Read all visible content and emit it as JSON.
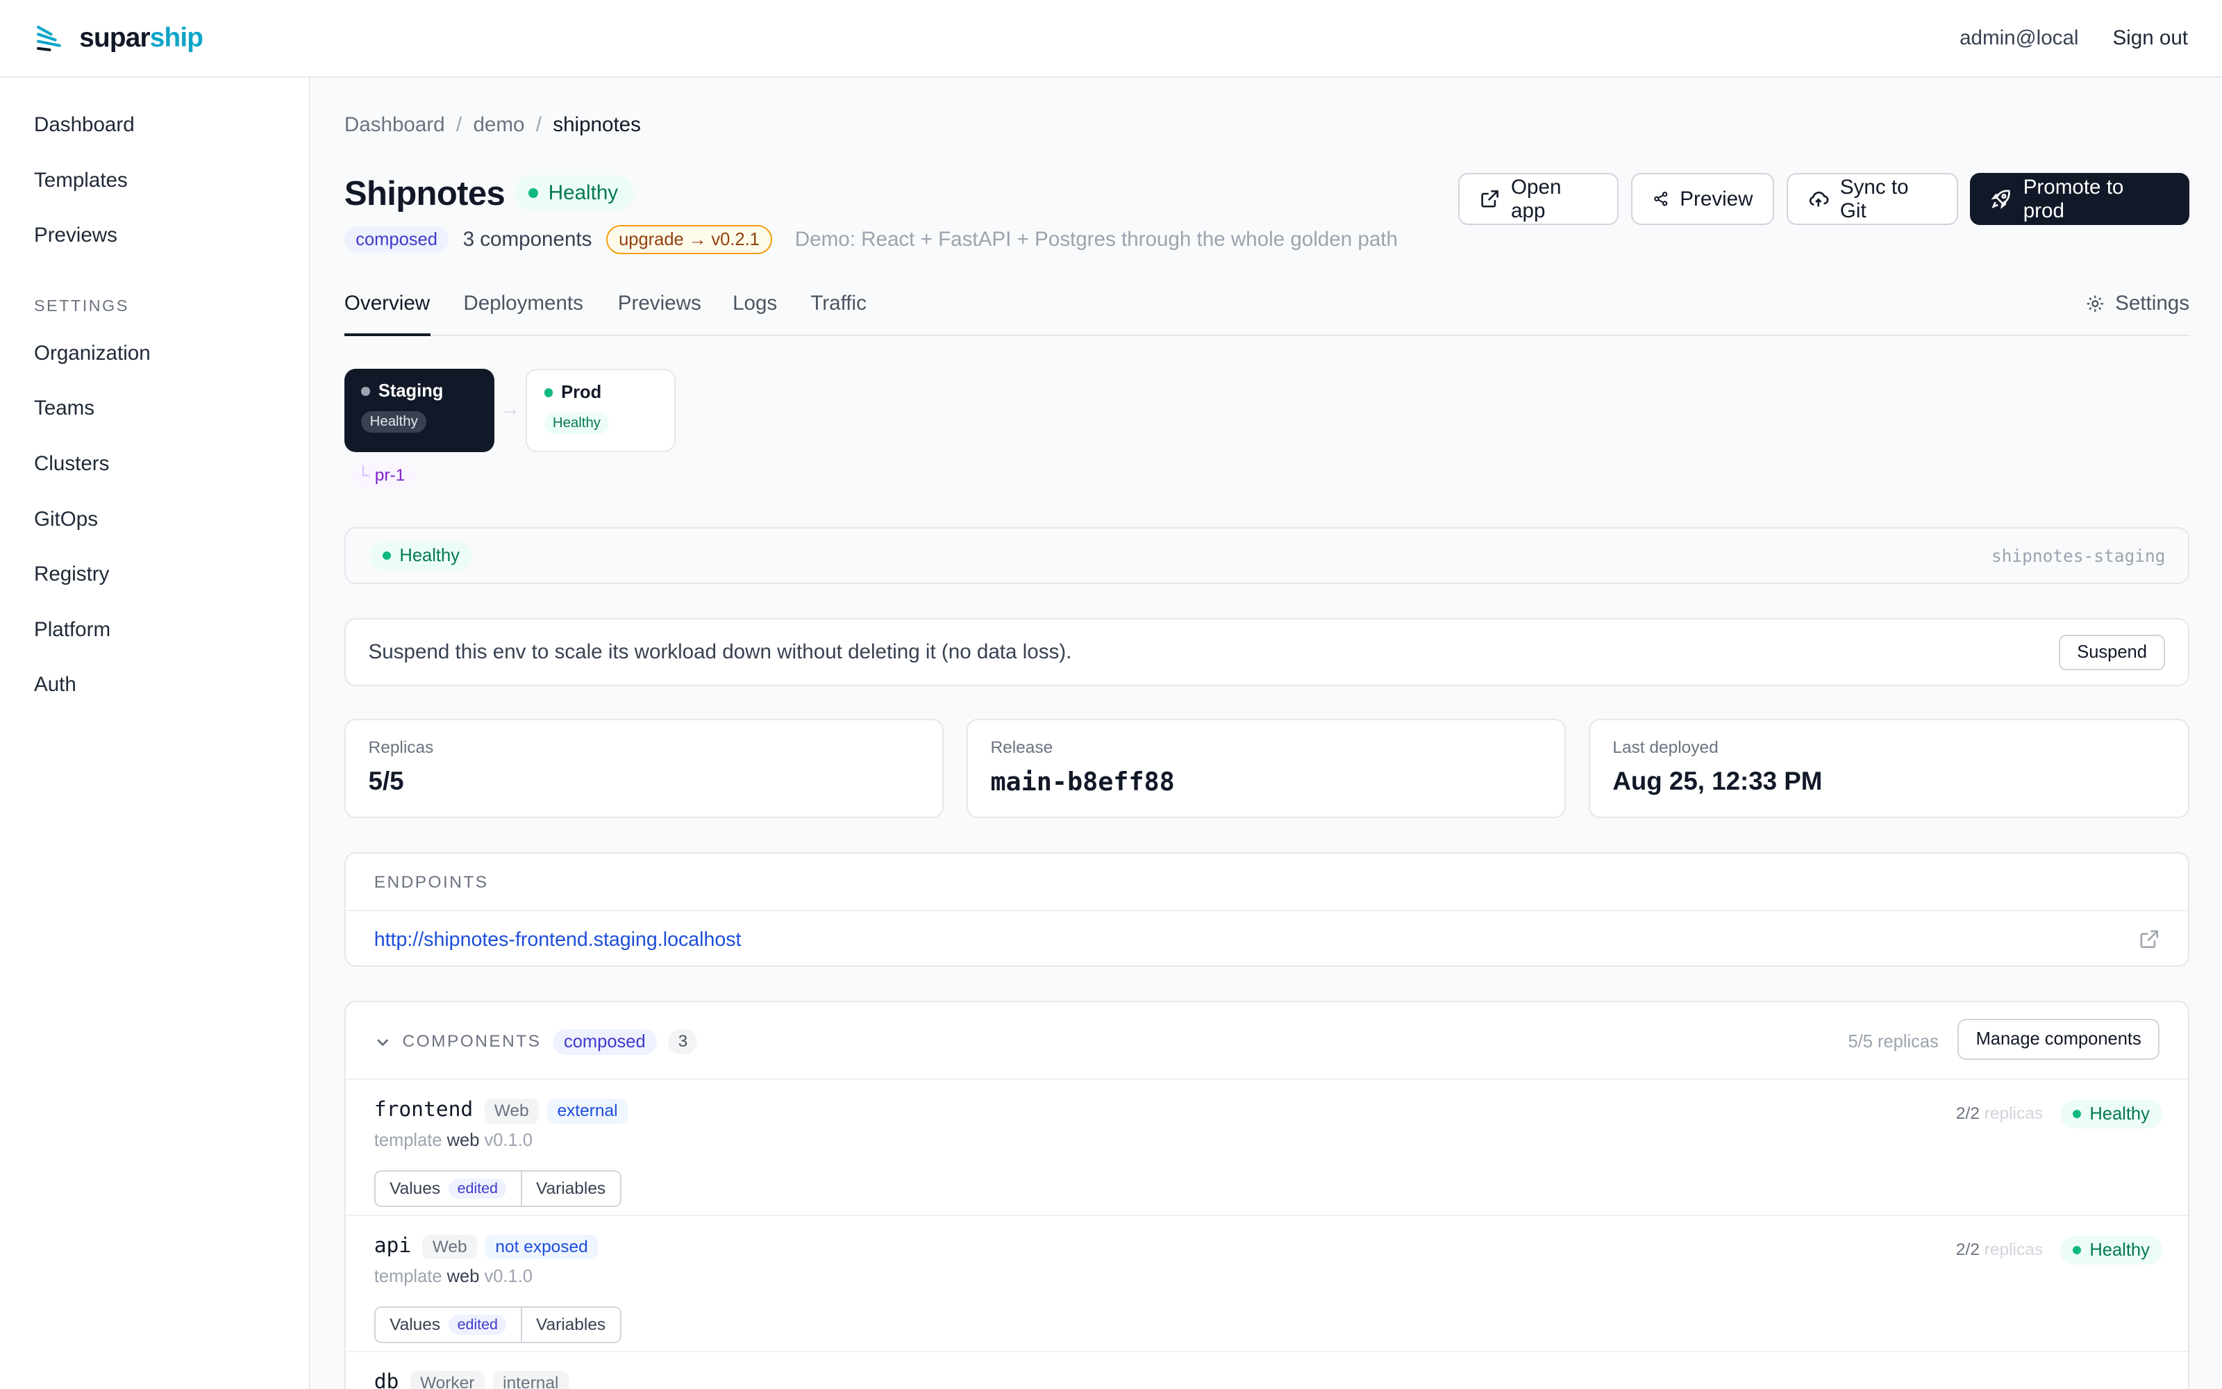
{
  "brand": {
    "part1": "supar",
    "part2": "ship"
  },
  "topbar": {
    "user": "admin@local",
    "signout": "Sign out"
  },
  "sidebar": {
    "items": [
      "Dashboard",
      "Templates",
      "Previews"
    ],
    "settings_header": "SETTINGS",
    "settings_items": [
      "Organization",
      "Teams",
      "Clusters",
      "GitOps",
      "Registry",
      "Platform",
      "Auth"
    ]
  },
  "breadcrumb": {
    "items": [
      "Dashboard",
      "demo",
      "shipnotes"
    ],
    "sep": "/"
  },
  "app": {
    "title": "Shipnotes",
    "status": "Healthy",
    "tag": "composed",
    "components": "3 components",
    "upgrade": "upgrade → v0.2.1",
    "description": "Demo: React + FastAPI + Postgres through the whole golden path"
  },
  "actions": {
    "open_app": "Open app",
    "preview": "Preview",
    "sync": "Sync to Git",
    "promote": "Promote to prod"
  },
  "tabs": {
    "items": [
      "Overview",
      "Deployments",
      "Previews",
      "Logs",
      "Traffic"
    ],
    "settings": "Settings"
  },
  "envs": {
    "staging": {
      "name": "Staging",
      "status": "Healthy"
    },
    "prod": {
      "name": "Prod",
      "status": "Healthy"
    },
    "preview": "pr-1"
  },
  "env_status": {
    "status": "Healthy",
    "namespace": "shipnotes-staging"
  },
  "suspend": {
    "text": "Suspend this env to scale its workload down without deleting it (no data loss).",
    "button": "Suspend"
  },
  "stats": {
    "replicas": {
      "label": "Replicas",
      "value": "5/5"
    },
    "release": {
      "label": "Release",
      "value": "main-b8eff88"
    },
    "last_deployed": {
      "label": "Last deployed",
      "value": "Aug 25, 12:33 PM"
    }
  },
  "endpoints": {
    "label": "ENDPOINTS",
    "url": "http://shipnotes-frontend.staging.localhost"
  },
  "components": {
    "label": "COMPONENTS",
    "tag": "composed",
    "count": "3",
    "replicas": "5/5 replicas",
    "manage": "Manage components",
    "rows": [
      {
        "name": "frontend",
        "kind": "Web",
        "exposure": "external",
        "tpl_prefix": "template",
        "tpl_name": "web",
        "tpl_version": "v0.1.0",
        "replicas": "2/2",
        "replicas_word": "replicas",
        "status": "Healthy",
        "values": "Values",
        "edited": "edited",
        "variables": "Variables"
      },
      {
        "name": "api",
        "kind": "Web",
        "exposure": "not exposed",
        "tpl_prefix": "template",
        "tpl_name": "web",
        "tpl_version": "v0.1.0",
        "replicas": "2/2",
        "replicas_word": "replicas",
        "status": "Healthy",
        "values": "Values",
        "edited": "edited",
        "variables": "Variables"
      },
      {
        "name": "db",
        "kind": "Worker",
        "exposure": "internal"
      }
    ]
  },
  "colors": {
    "accent": "#0ea5c8",
    "dark": "#111827",
    "healthy": "#10b981",
    "link": "#1d4ed8"
  },
  "icons": [
    "logo-icon",
    "external-link-icon",
    "share-icon",
    "cloud-upload-icon",
    "rocket-icon",
    "gear-icon",
    "chevron-down-icon",
    "arrow-right-icon",
    "branch-icon"
  ]
}
